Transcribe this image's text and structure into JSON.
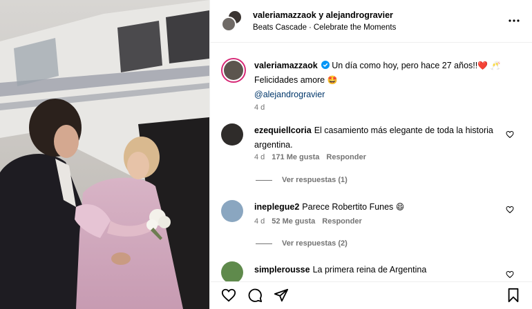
{
  "header": {
    "user1": "valeriamazzaok",
    "conj": " y ",
    "user2": "alejandrogravier",
    "audio_artist": "Beats Cascade",
    "audio_sep": "·",
    "audio_title": "Celebrate the Moments",
    "more_icon": "more-horizontal-icon"
  },
  "caption": {
    "username": "valeriamazzaok",
    "verified_icon": "verified-badge-icon",
    "text_line1": "Un día como hoy, pero hace 27 años!!",
    "emoji1": "❤️",
    "emoji2": "🥂",
    "text_line2": "Felicidades amore",
    "emoji3": "🤩",
    "mention": "@alejandrogravier",
    "time": "4 d"
  },
  "comments": [
    {
      "username": "ezequiellcoria",
      "text": "El casamiento más elegante de toda la historia argentina.",
      "time": "4 d",
      "likes": "171 Me gusta",
      "reply": "Responder",
      "view_replies": "Ver respuestas (1)"
    },
    {
      "username": "ineplegue2",
      "text": "Parece Robertito Funes",
      "emoji": "😄",
      "time": "4 d",
      "likes": "52 Me gusta",
      "reply": "Responder",
      "view_replies": "Ver respuestas (2)"
    },
    {
      "username": "simplerousse",
      "text": "La primera reina de Argentina"
    }
  ],
  "actions": {
    "like_icon": "heart-icon",
    "comment_icon": "comment-icon",
    "share_icon": "send-icon",
    "save_icon": "bookmark-icon"
  },
  "colors": {
    "link": "#00376b",
    "secondary_text": "#737373",
    "verified": "#0095f6",
    "divider": "#efefef"
  }
}
